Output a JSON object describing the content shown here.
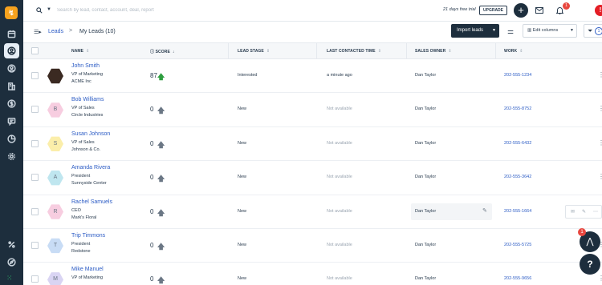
{
  "nav": {
    "logo_glyph": "↯",
    "items": [
      {
        "icon": "calendar-icon"
      },
      {
        "icon": "contacts-icon",
        "active": true
      },
      {
        "icon": "user-icon"
      },
      {
        "icon": "building-icon"
      },
      {
        "icon": "dollar-icon"
      },
      {
        "icon": "chat-icon"
      },
      {
        "icon": "reports-icon"
      },
      {
        "icon": "settings-icon"
      }
    ],
    "bottom_items": [
      {
        "icon": "percent-icon"
      },
      {
        "icon": "compass-icon"
      },
      {
        "icon": "apps-grid-icon"
      }
    ]
  },
  "topbar": {
    "search_placeholder": "Search by lead, contact, account, deal, report",
    "trial_text": "21 days free trial",
    "upgrade_label": "UPGRADE",
    "plus_label": "+",
    "bell_badge": "1",
    "alert_label": "!"
  },
  "subheader": {
    "breadcrumb_root": "Leads",
    "breadcrumb_sep": ">",
    "title": "My Leads (10)",
    "import_label": "Import leads",
    "edit_columns_label": "Edit columns",
    "filter_count": "1"
  },
  "columns": {
    "name": "NAME",
    "score": "SCORE",
    "stage": "LEAD STAGE",
    "contacted": "LAST CONTACTED TIME",
    "owner": "SALES OWNER",
    "work": "WORK"
  },
  "rows": [
    {
      "name": "John Smith",
      "title": "VP of Marketing",
      "company": "ACME Inc",
      "initial": "",
      "avatar_bg": "#3b2a22",
      "score": "87",
      "score_trend": "up",
      "stage": "Interested",
      "contacted": "a minute ago",
      "owner": "Dan Taylor",
      "work": "202-555-1234"
    },
    {
      "name": "Bob Williams",
      "title": "VP of Sales",
      "company": "Circle Industries",
      "initial": "B",
      "avatar_bg": "#f7cde0",
      "score": "0",
      "score_trend": "neutral",
      "stage": "New",
      "contacted": "Not available",
      "owner": "Dan Taylor",
      "work": "202-555-8752"
    },
    {
      "name": "Susan Johnson",
      "title": "VP of Sales",
      "company": "Johnson & Co.",
      "initial": "S",
      "avatar_bg": "#fbeeaa",
      "score": "0",
      "score_trend": "neutral",
      "stage": "New",
      "contacted": "Not available",
      "owner": "Dan Taylor",
      "work": "202-555-6432"
    },
    {
      "name": "Amanda Rivera",
      "title": "President",
      "company": "Sunnyside Center",
      "initial": "A",
      "avatar_bg": "#bfe6ef",
      "score": "0",
      "score_trend": "neutral",
      "stage": "New",
      "contacted": "Not available",
      "owner": "Dan Taylor",
      "work": "202-555-3642"
    },
    {
      "name": "Rachel Samuels",
      "title": "CEO",
      "company": "Mark's Floral",
      "initial": "R",
      "avatar_bg": "#f7cde0",
      "score": "0",
      "score_trend": "neutral",
      "stage": "New",
      "contacted": "Not available",
      "owner": "Dan Taylor",
      "work": "202-555-1664",
      "hovered": true
    },
    {
      "name": "Trip Timmons",
      "title": "President",
      "company": "Redstone",
      "initial": "T",
      "avatar_bg": "#c8dcf5",
      "score": "0",
      "score_trend": "neutral",
      "stage": "New",
      "contacted": "Not available",
      "owner": "Dan Taylor",
      "work": "202-555-5725"
    },
    {
      "name": "Mike Manuel",
      "title": "VP of Marketing",
      "company": "",
      "initial": "M",
      "avatar_bg": "#d9d4f3",
      "score": "0",
      "score_trend": "neutral",
      "stage": "New",
      "contacted": "Not available",
      "owner": "Dan Taylor",
      "work": "202-555-9656"
    }
  ],
  "colors": {
    "nav_bg": "#1d2e3d",
    "link": "#2c5cc5",
    "score_up": "#2e9e3f",
    "score_neutral": "#6b7785",
    "muted": "#9aa5b1",
    "alert": "#e41e26"
  },
  "floating": {
    "brand_badge": "1",
    "help_label": "?"
  }
}
